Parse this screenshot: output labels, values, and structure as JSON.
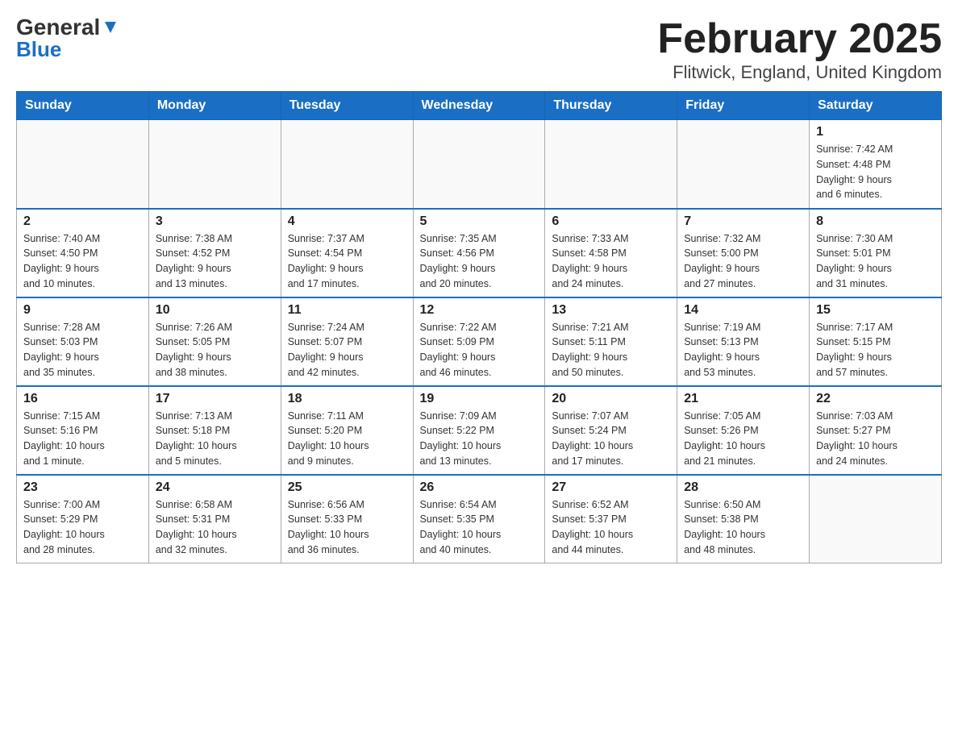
{
  "header": {
    "logo_general": "General",
    "logo_blue": "Blue",
    "title": "February 2025",
    "subtitle": "Flitwick, England, United Kingdom"
  },
  "weekdays": [
    "Sunday",
    "Monday",
    "Tuesday",
    "Wednesday",
    "Thursday",
    "Friday",
    "Saturday"
  ],
  "weeks": [
    [
      {
        "day": "",
        "info": ""
      },
      {
        "day": "",
        "info": ""
      },
      {
        "day": "",
        "info": ""
      },
      {
        "day": "",
        "info": ""
      },
      {
        "day": "",
        "info": ""
      },
      {
        "day": "",
        "info": ""
      },
      {
        "day": "1",
        "info": "Sunrise: 7:42 AM\nSunset: 4:48 PM\nDaylight: 9 hours\nand 6 minutes."
      }
    ],
    [
      {
        "day": "2",
        "info": "Sunrise: 7:40 AM\nSunset: 4:50 PM\nDaylight: 9 hours\nand 10 minutes."
      },
      {
        "day": "3",
        "info": "Sunrise: 7:38 AM\nSunset: 4:52 PM\nDaylight: 9 hours\nand 13 minutes."
      },
      {
        "day": "4",
        "info": "Sunrise: 7:37 AM\nSunset: 4:54 PM\nDaylight: 9 hours\nand 17 minutes."
      },
      {
        "day": "5",
        "info": "Sunrise: 7:35 AM\nSunset: 4:56 PM\nDaylight: 9 hours\nand 20 minutes."
      },
      {
        "day": "6",
        "info": "Sunrise: 7:33 AM\nSunset: 4:58 PM\nDaylight: 9 hours\nand 24 minutes."
      },
      {
        "day": "7",
        "info": "Sunrise: 7:32 AM\nSunset: 5:00 PM\nDaylight: 9 hours\nand 27 minutes."
      },
      {
        "day": "8",
        "info": "Sunrise: 7:30 AM\nSunset: 5:01 PM\nDaylight: 9 hours\nand 31 minutes."
      }
    ],
    [
      {
        "day": "9",
        "info": "Sunrise: 7:28 AM\nSunset: 5:03 PM\nDaylight: 9 hours\nand 35 minutes."
      },
      {
        "day": "10",
        "info": "Sunrise: 7:26 AM\nSunset: 5:05 PM\nDaylight: 9 hours\nand 38 minutes."
      },
      {
        "day": "11",
        "info": "Sunrise: 7:24 AM\nSunset: 5:07 PM\nDaylight: 9 hours\nand 42 minutes."
      },
      {
        "day": "12",
        "info": "Sunrise: 7:22 AM\nSunset: 5:09 PM\nDaylight: 9 hours\nand 46 minutes."
      },
      {
        "day": "13",
        "info": "Sunrise: 7:21 AM\nSunset: 5:11 PM\nDaylight: 9 hours\nand 50 minutes."
      },
      {
        "day": "14",
        "info": "Sunrise: 7:19 AM\nSunset: 5:13 PM\nDaylight: 9 hours\nand 53 minutes."
      },
      {
        "day": "15",
        "info": "Sunrise: 7:17 AM\nSunset: 5:15 PM\nDaylight: 9 hours\nand 57 minutes."
      }
    ],
    [
      {
        "day": "16",
        "info": "Sunrise: 7:15 AM\nSunset: 5:16 PM\nDaylight: 10 hours\nand 1 minute."
      },
      {
        "day": "17",
        "info": "Sunrise: 7:13 AM\nSunset: 5:18 PM\nDaylight: 10 hours\nand 5 minutes."
      },
      {
        "day": "18",
        "info": "Sunrise: 7:11 AM\nSunset: 5:20 PM\nDaylight: 10 hours\nand 9 minutes."
      },
      {
        "day": "19",
        "info": "Sunrise: 7:09 AM\nSunset: 5:22 PM\nDaylight: 10 hours\nand 13 minutes."
      },
      {
        "day": "20",
        "info": "Sunrise: 7:07 AM\nSunset: 5:24 PM\nDaylight: 10 hours\nand 17 minutes."
      },
      {
        "day": "21",
        "info": "Sunrise: 7:05 AM\nSunset: 5:26 PM\nDaylight: 10 hours\nand 21 minutes."
      },
      {
        "day": "22",
        "info": "Sunrise: 7:03 AM\nSunset: 5:27 PM\nDaylight: 10 hours\nand 24 minutes."
      }
    ],
    [
      {
        "day": "23",
        "info": "Sunrise: 7:00 AM\nSunset: 5:29 PM\nDaylight: 10 hours\nand 28 minutes."
      },
      {
        "day": "24",
        "info": "Sunrise: 6:58 AM\nSunset: 5:31 PM\nDaylight: 10 hours\nand 32 minutes."
      },
      {
        "day": "25",
        "info": "Sunrise: 6:56 AM\nSunset: 5:33 PM\nDaylight: 10 hours\nand 36 minutes."
      },
      {
        "day": "26",
        "info": "Sunrise: 6:54 AM\nSunset: 5:35 PM\nDaylight: 10 hours\nand 40 minutes."
      },
      {
        "day": "27",
        "info": "Sunrise: 6:52 AM\nSunset: 5:37 PM\nDaylight: 10 hours\nand 44 minutes."
      },
      {
        "day": "28",
        "info": "Sunrise: 6:50 AM\nSunset: 5:38 PM\nDaylight: 10 hours\nand 48 minutes."
      },
      {
        "day": "",
        "info": ""
      }
    ]
  ]
}
